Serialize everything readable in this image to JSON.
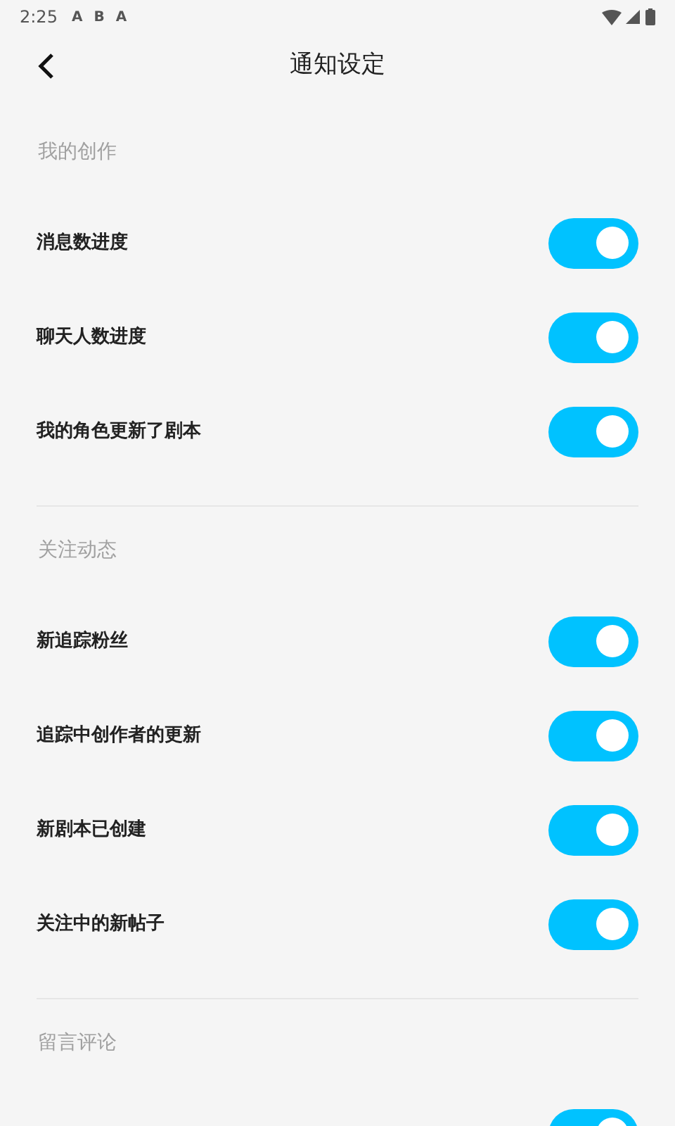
{
  "status_bar": {
    "time": "2:25",
    "notification_icons": [
      "A",
      "B",
      "A"
    ]
  },
  "header": {
    "title": "通知设定"
  },
  "sections": [
    {
      "title": "我的创作",
      "items": [
        {
          "label": "消息数进度",
          "on": true
        },
        {
          "label": "聊天人数进度",
          "on": true
        },
        {
          "label": "我的角色更新了剧本",
          "on": true
        }
      ]
    },
    {
      "title": "关注动态",
      "items": [
        {
          "label": "新追踪粉丝",
          "on": true
        },
        {
          "label": "追踪中创作者的更新",
          "on": true
        },
        {
          "label": "新剧本已创建",
          "on": true
        },
        {
          "label": "关注中的新帖子",
          "on": true
        }
      ]
    },
    {
      "title": "留言评论",
      "items": [
        {
          "on": true
        }
      ]
    }
  ]
}
